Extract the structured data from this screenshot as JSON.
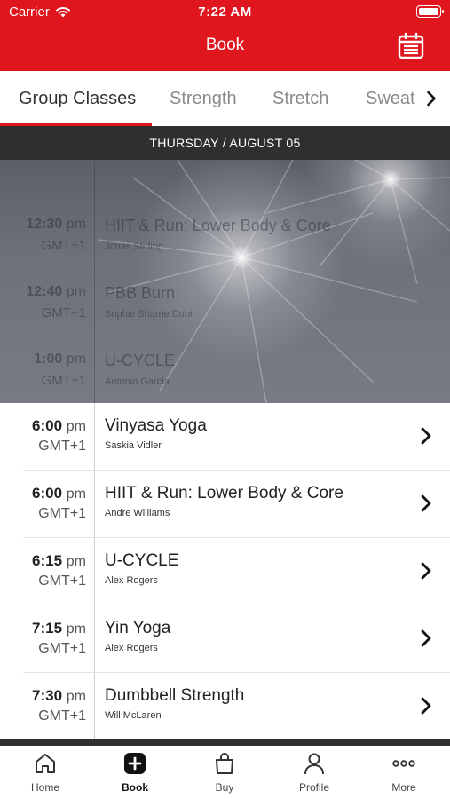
{
  "status_bar": {
    "carrier": "Carrier",
    "time": "7:22 AM"
  },
  "nav": {
    "title": "Book",
    "calendar_icon": "calendar-icon"
  },
  "tabs": [
    {
      "label": "Group Classes",
      "active": true
    },
    {
      "label": "Strength",
      "active": false
    },
    {
      "label": "Stretch",
      "active": false
    },
    {
      "label": "Sweat",
      "active": false
    }
  ],
  "date_header": "THURSDAY / AUGUST 05",
  "past_classes": [
    {
      "time": "12:30",
      "ampm": "pm",
      "tz": "GMT+1",
      "name": "HIIT & Run: Lower Body & Core",
      "instructor": "Jonas Stirling"
    },
    {
      "time": "12:40",
      "ampm": "pm",
      "tz": "GMT+1",
      "name": "PBB Burn",
      "instructor": "Sophie Sharrie Dubi"
    },
    {
      "time": "1:00",
      "ampm": "pm",
      "tz": "GMT+1",
      "name": "U-CYCLE",
      "instructor": "Antonio Garcia"
    }
  ],
  "classes": [
    {
      "time": "6:00",
      "ampm": "pm",
      "tz": "GMT+1",
      "name": "Vinyasa Yoga",
      "instructor": "Saskia Vidler"
    },
    {
      "time": "6:00",
      "ampm": "pm",
      "tz": "GMT+1",
      "name": "HIIT & Run: Lower Body & Core",
      "instructor": "Andre Williams"
    },
    {
      "time": "6:15",
      "ampm": "pm",
      "tz": "GMT+1",
      "name": "U-CYCLE",
      "instructor": "Alex Rogers"
    },
    {
      "time": "7:15",
      "ampm": "pm",
      "tz": "GMT+1",
      "name": "Yin Yoga",
      "instructor": "Alex Rogers"
    },
    {
      "time": "7:30",
      "ampm": "pm",
      "tz": "GMT+1",
      "name": "Dumbbell Strength",
      "instructor": "Will McLaren"
    }
  ],
  "tab_bar": [
    {
      "label": "Home",
      "icon": "home-icon",
      "active": false
    },
    {
      "label": "Book",
      "icon": "plus-square-icon",
      "active": true
    },
    {
      "label": "Buy",
      "icon": "bag-icon",
      "active": false
    },
    {
      "label": "Profile",
      "icon": "person-icon",
      "active": false
    },
    {
      "label": "More",
      "icon": "more-dots-icon",
      "active": false
    }
  ],
  "colors": {
    "brand": "#e0161e",
    "dark_bar": "#2f2f2f"
  }
}
